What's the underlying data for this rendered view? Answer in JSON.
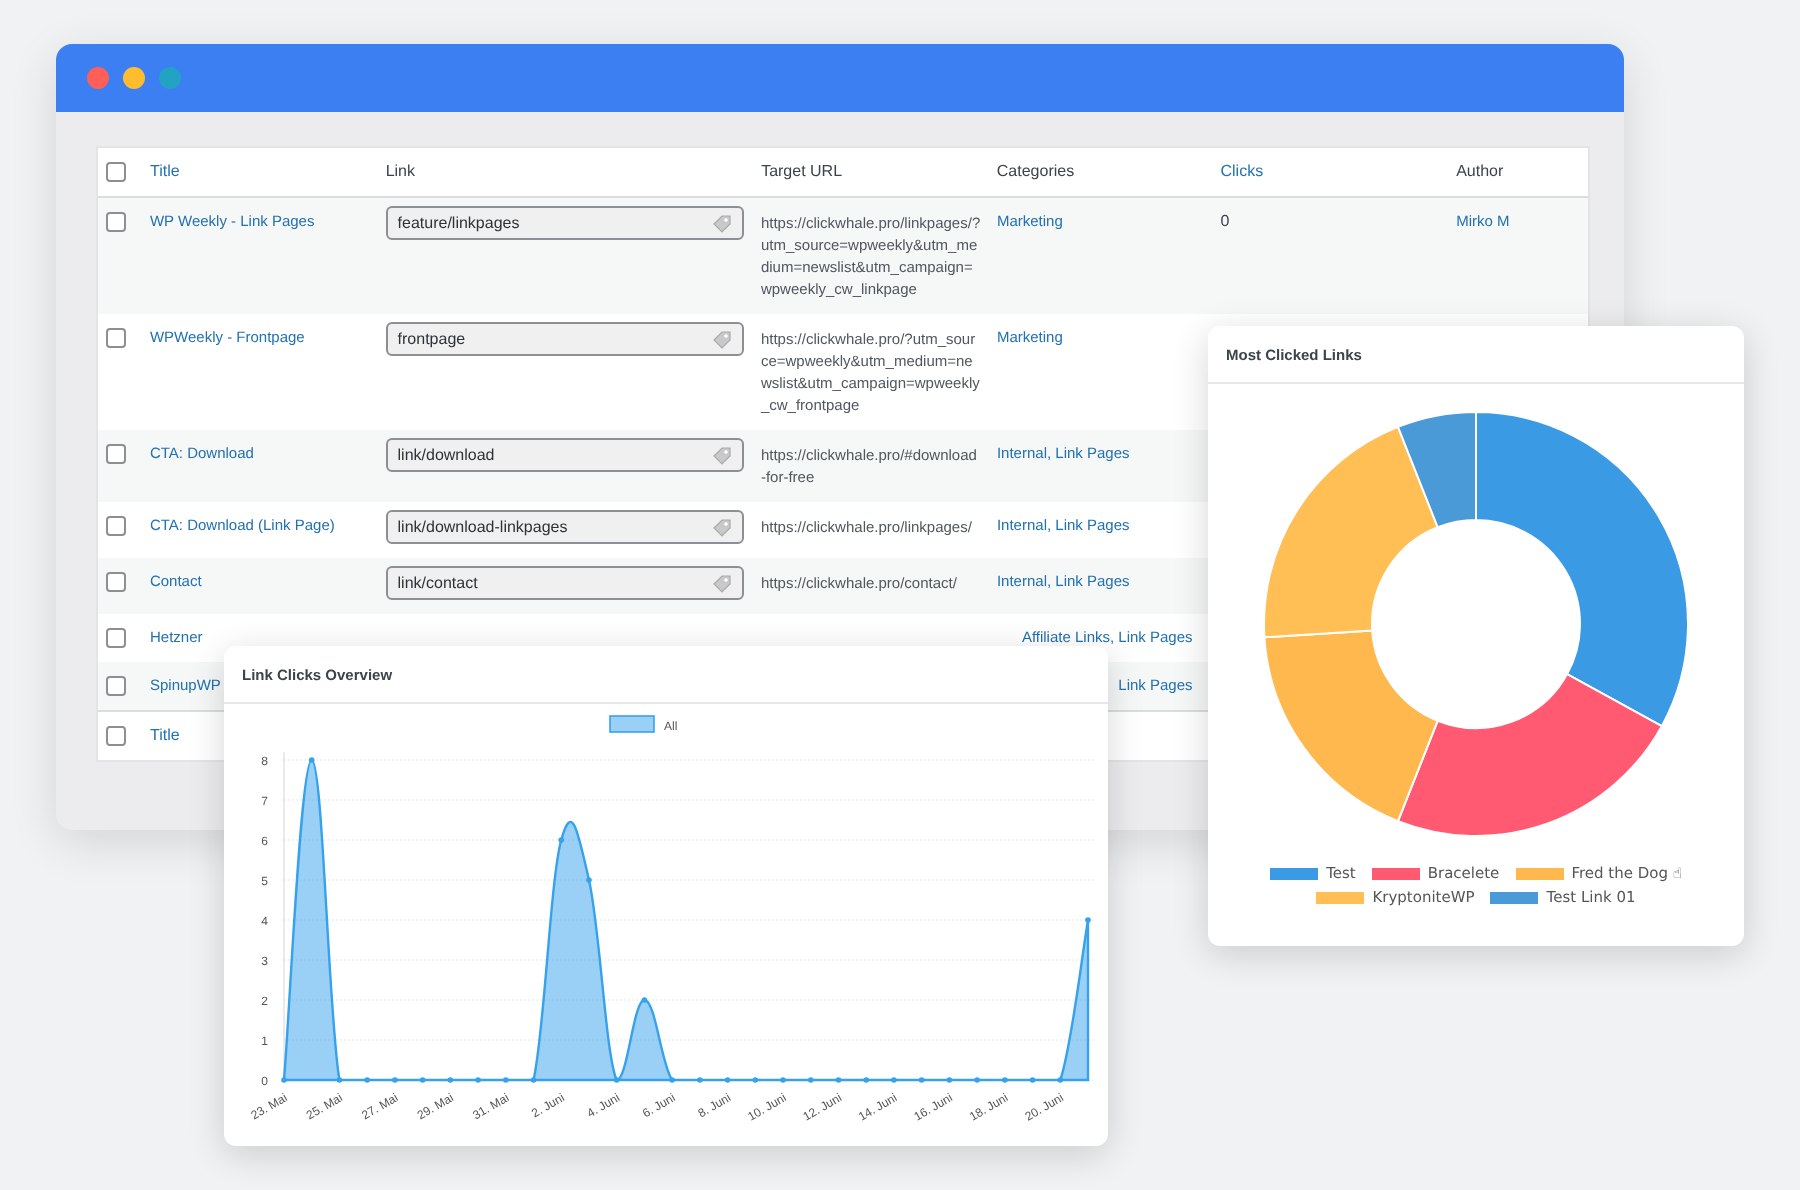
{
  "table": {
    "columns": [
      {
        "label": "Title",
        "sortable": true
      },
      {
        "label": "Link",
        "sortable": false
      },
      {
        "label": "Target URL",
        "sortable": false
      },
      {
        "label": "Categories",
        "sortable": false
      },
      {
        "label": "Clicks",
        "sortable": true
      },
      {
        "label": "Author",
        "sortable": false
      }
    ],
    "rows": [
      {
        "checked": false,
        "title": "WP Weekly - Link Pages",
        "link": "feature/linkpages",
        "url": "https://clickwhale.pro/linkpages/?utm_source=wpweekly&utm_medium=newslist&utm_campaign=wpweekly_cw_linkpage",
        "categories": "Marketing",
        "clicks": "0",
        "author": "Mirko M"
      },
      {
        "checked": false,
        "title": "WPWeekly - Frontpage",
        "link": "frontpage",
        "url": "https://clickwhale.pro/?utm_source=wpweekly&utm_medium=newslist&utm_campaign=wpweekly_cw_frontpage",
        "categories": "Marketing"
      },
      {
        "checked": false,
        "title": "CTA: Download",
        "link": "link/download",
        "url": "https://clickwhale.pro/#download-for-free",
        "categories": "Internal, Link Pages"
      },
      {
        "checked": false,
        "title": "CTA: Download (Link Page)",
        "link": "link/download-linkpages",
        "url": "https://clickwhale.pro/linkpages/",
        "categories": "Internal, Link Pages"
      },
      {
        "checked": false,
        "title": "Contact",
        "link": "link/contact",
        "url": "https://clickwhale.pro/contact/",
        "categories": "Internal, Link Pages"
      },
      {
        "checked": false,
        "title": "Hetzner",
        "categories": "Affiliate Links, Link Pages"
      },
      {
        "checked": false,
        "title": "SpinupWP",
        "categories": "Link Pages"
      }
    ],
    "header": {
      "checked": false
    },
    "footer": [
      {
        "label": "Title",
        "sortable": true,
        "checked": false
      }
    ]
  },
  "line_chart": {
    "title": "Link Clicks Overview",
    "chart_data": {
      "type": "area",
      "categories": [
        "23. Mai",
        null,
        "25. Mai",
        null,
        "27. Mai",
        null,
        "29. Mai",
        null,
        "31. Mai",
        null,
        "2. Juni",
        null,
        "4. Juni",
        null,
        "6. Juni",
        null,
        "8. Juni",
        null,
        "10. Juni",
        null,
        "12. Juni",
        null,
        "14. Juni",
        null,
        "16. Juni",
        null,
        "18. Juni",
        null,
        "20. Juni",
        null
      ],
      "series": [
        {
          "name": "All",
          "color": "#36a2eb",
          "values": [
            0,
            8,
            0,
            0,
            0,
            0,
            0,
            0,
            0,
            0,
            6,
            5,
            0,
            2,
            0,
            0,
            0,
            0,
            0,
            0,
            0,
            0,
            0,
            0,
            0,
            0,
            0,
            0,
            0,
            4
          ]
        }
      ],
      "ylim": [
        0,
        8
      ],
      "yticks": [
        0,
        1,
        2,
        3,
        4,
        5,
        6,
        7,
        8
      ],
      "grid": true
    }
  },
  "donut_chart": {
    "title": "Most Clicked Links",
    "chart_data": {
      "type": "donut",
      "categories": [
        "Test",
        "Bracelete",
        "Fred the Dog ☝",
        "KryptoniteWP",
        "Test Link 01"
      ],
      "colors": [
        "#3a9ae4",
        "#ff5a72",
        "#ffb84d",
        "#ffbf55",
        "#4a9ad8"
      ],
      "series": [
        {
          "values": [
            33,
            23,
            18,
            20,
            6
          ]
        }
      ]
    }
  }
}
